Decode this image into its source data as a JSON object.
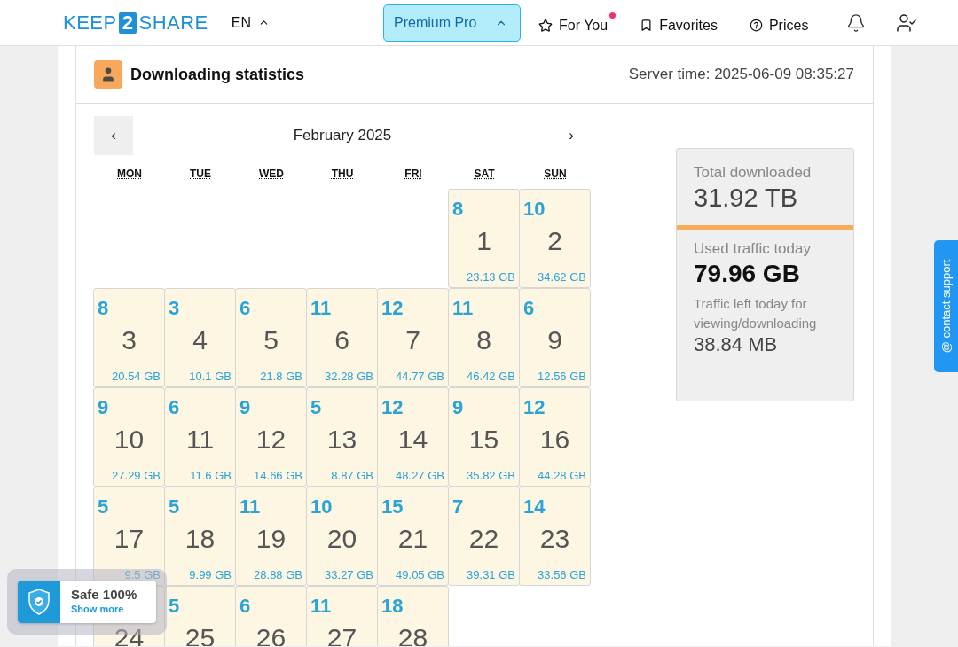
{
  "header": {
    "logo": {
      "left": "KEEP",
      "mid": "2",
      "right": "SHARE"
    },
    "language": "EN",
    "plan": "Premium Pro",
    "nav": [
      {
        "kind": "star",
        "label": "For You",
        "badge": true
      },
      {
        "kind": "bookmark",
        "label": "Favorites",
        "badge": false
      },
      {
        "kind": "help",
        "label": "Prices",
        "badge": false
      }
    ]
  },
  "panel": {
    "title": "Downloading statistics",
    "server_time": "Server time: 2025-06-09 08:35:27"
  },
  "calendar": {
    "prev": "‹",
    "month": "February 2025",
    "next": "›",
    "weekdays": [
      "MON",
      "TUE",
      "WED",
      "THU",
      "FRI",
      "SAT",
      "SUN"
    ],
    "days": [
      {
        "count": "8",
        "date": "1",
        "size": "23.13 GB"
      },
      {
        "count": "10",
        "date": "2",
        "size": "34.62 GB"
      },
      {
        "count": "8",
        "date": "3",
        "size": "20.54 GB"
      },
      {
        "count": "3",
        "date": "4",
        "size": "10.1 GB"
      },
      {
        "count": "6",
        "date": "5",
        "size": "21.8 GB"
      },
      {
        "count": "11",
        "date": "6",
        "size": "32.28 GB"
      },
      {
        "count": "12",
        "date": "7",
        "size": "44.77 GB"
      },
      {
        "count": "11",
        "date": "8",
        "size": "46.42 GB"
      },
      {
        "count": "6",
        "date": "9",
        "size": "12.56 GB"
      },
      {
        "count": "9",
        "date": "10",
        "size": "27.29 GB"
      },
      {
        "count": "6",
        "date": "11",
        "size": "11.6 GB"
      },
      {
        "count": "9",
        "date": "12",
        "size": "14.66 GB"
      },
      {
        "count": "5",
        "date": "13",
        "size": "8.87 GB"
      },
      {
        "count": "12",
        "date": "14",
        "size": "48.27 GB"
      },
      {
        "count": "9",
        "date": "15",
        "size": "35.82 GB"
      },
      {
        "count": "12",
        "date": "16",
        "size": "44.28 GB"
      },
      {
        "count": "5",
        "date": "17",
        "size": "9.5 GB"
      },
      {
        "count": "5",
        "date": "18",
        "size": "9.99 GB"
      },
      {
        "count": "11",
        "date": "19",
        "size": "28.88 GB"
      },
      {
        "count": "10",
        "date": "20",
        "size": "33.27 GB"
      },
      {
        "count": "15",
        "date": "21",
        "size": "49.05 GB"
      },
      {
        "count": "7",
        "date": "22",
        "size": "39.31 GB"
      },
      {
        "count": "14",
        "date": "23",
        "size": "33.56 GB"
      },
      {
        "date": "24"
      },
      {
        "count": "5",
        "date": "25"
      },
      {
        "count": "6",
        "date": "26"
      },
      {
        "count": "11",
        "date": "27"
      },
      {
        "count": "18",
        "date": "28"
      }
    ]
  },
  "stats": {
    "total_label": "Total downloaded",
    "total_value": "31.92 TB",
    "used_label": "Used traffic today",
    "used_value": "79.96 GB",
    "left_label": "Traffic left today for viewing/downloading",
    "left_value": "38.84 MB"
  },
  "support_tab": "@ contact support",
  "safe_widget": {
    "title": "Safe 100%",
    "link": "Show more"
  }
}
